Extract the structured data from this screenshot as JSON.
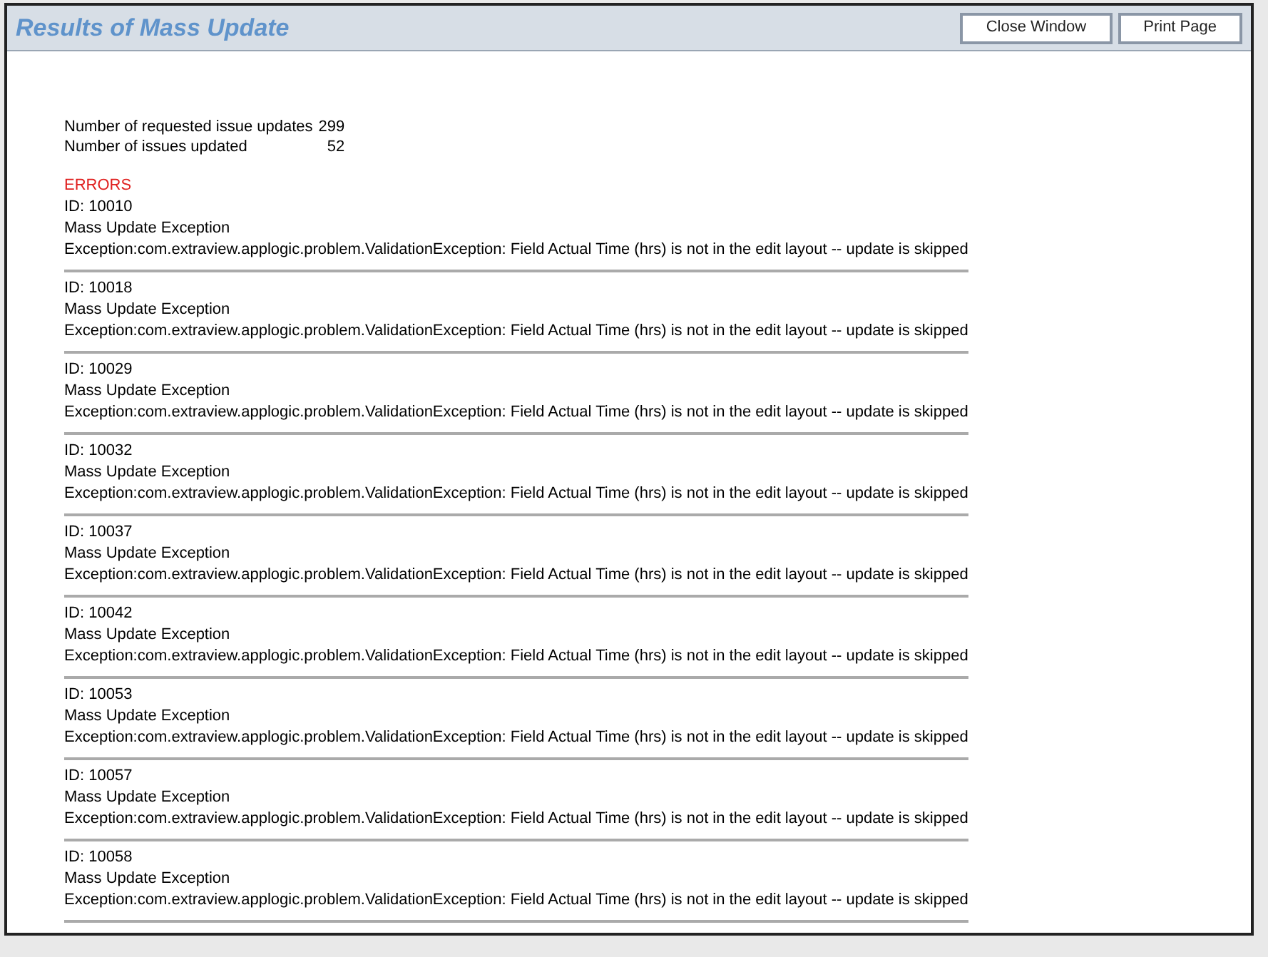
{
  "header": {
    "title": "Results of Mass Update",
    "buttons": [
      "Close Window",
      "Print Page"
    ]
  },
  "summary": [
    {
      "label": "Number of requested issue updates",
      "value": "299"
    },
    {
      "label": "Number of issues updated",
      "value": "52"
    }
  ],
  "errors_heading": "ERRORS",
  "errors": [
    {
      "id": "ID: 10010",
      "title": "Mass Update Exception",
      "message": "Exception:com.extraview.applogic.problem.ValidationException: Field Actual Time (hrs) is not in the edit layout -- update is skipped"
    },
    {
      "id": "ID: 10018",
      "title": "Mass Update Exception",
      "message": "Exception:com.extraview.applogic.problem.ValidationException: Field Actual Time (hrs) is not in the edit layout -- update is skipped"
    },
    {
      "id": "ID: 10029",
      "title": "Mass Update Exception",
      "message": "Exception:com.extraview.applogic.problem.ValidationException: Field Actual Time (hrs) is not in the edit layout -- update is skipped"
    },
    {
      "id": "ID: 10032",
      "title": "Mass Update Exception",
      "message": "Exception:com.extraview.applogic.problem.ValidationException: Field Actual Time (hrs) is not in the edit layout -- update is skipped"
    },
    {
      "id": "ID: 10037",
      "title": "Mass Update Exception",
      "message": "Exception:com.extraview.applogic.problem.ValidationException: Field Actual Time (hrs) is not in the edit layout -- update is skipped"
    },
    {
      "id": "ID: 10042",
      "title": "Mass Update Exception",
      "message": "Exception:com.extraview.applogic.problem.ValidationException: Field Actual Time (hrs) is not in the edit layout -- update is skipped"
    },
    {
      "id": "ID: 10053",
      "title": "Mass Update Exception",
      "message": "Exception:com.extraview.applogic.problem.ValidationException: Field Actual Time (hrs) is not in the edit layout -- update is skipped"
    },
    {
      "id": "ID: 10057",
      "title": "Mass Update Exception",
      "message": "Exception:com.extraview.applogic.problem.ValidationException: Field Actual Time (hrs) is not in the edit layout -- update is skipped"
    },
    {
      "id": "ID: 10058",
      "title": "Mass Update Exception",
      "message": "Exception:com.extraview.applogic.problem.ValidationException: Field Actual Time (hrs) is not in the edit layout -- update is skipped"
    }
  ]
}
